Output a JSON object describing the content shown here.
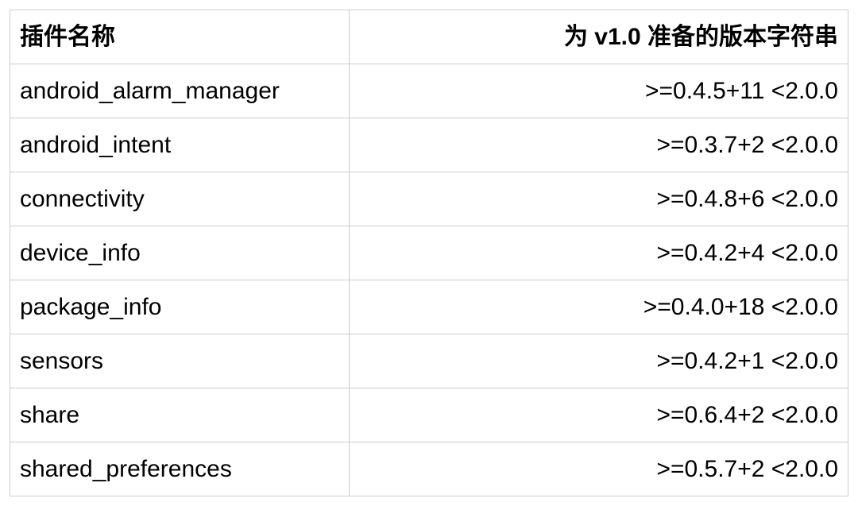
{
  "table": {
    "headers": {
      "name": "插件名称",
      "version": "为 v1.0 准备的版本字符串"
    },
    "rows": [
      {
        "name": "android_alarm_manager",
        "version": ">=0.4.5+11 <2.0.0"
      },
      {
        "name": "android_intent",
        "version": ">=0.3.7+2 <2.0.0"
      },
      {
        "name": "connectivity",
        "version": ">=0.4.8+6 <2.0.0"
      },
      {
        "name": "device_info",
        "version": ">=0.4.2+4 <2.0.0"
      },
      {
        "name": "package_info",
        "version": ">=0.4.0+18 <2.0.0"
      },
      {
        "name": "sensors",
        "version": ">=0.4.2+1 <2.0.0"
      },
      {
        "name": "share",
        "version": ">=0.6.4+2 <2.0.0"
      },
      {
        "name": "shared_preferences",
        "version": ">=0.5.7+2 <2.0.0"
      }
    ]
  }
}
